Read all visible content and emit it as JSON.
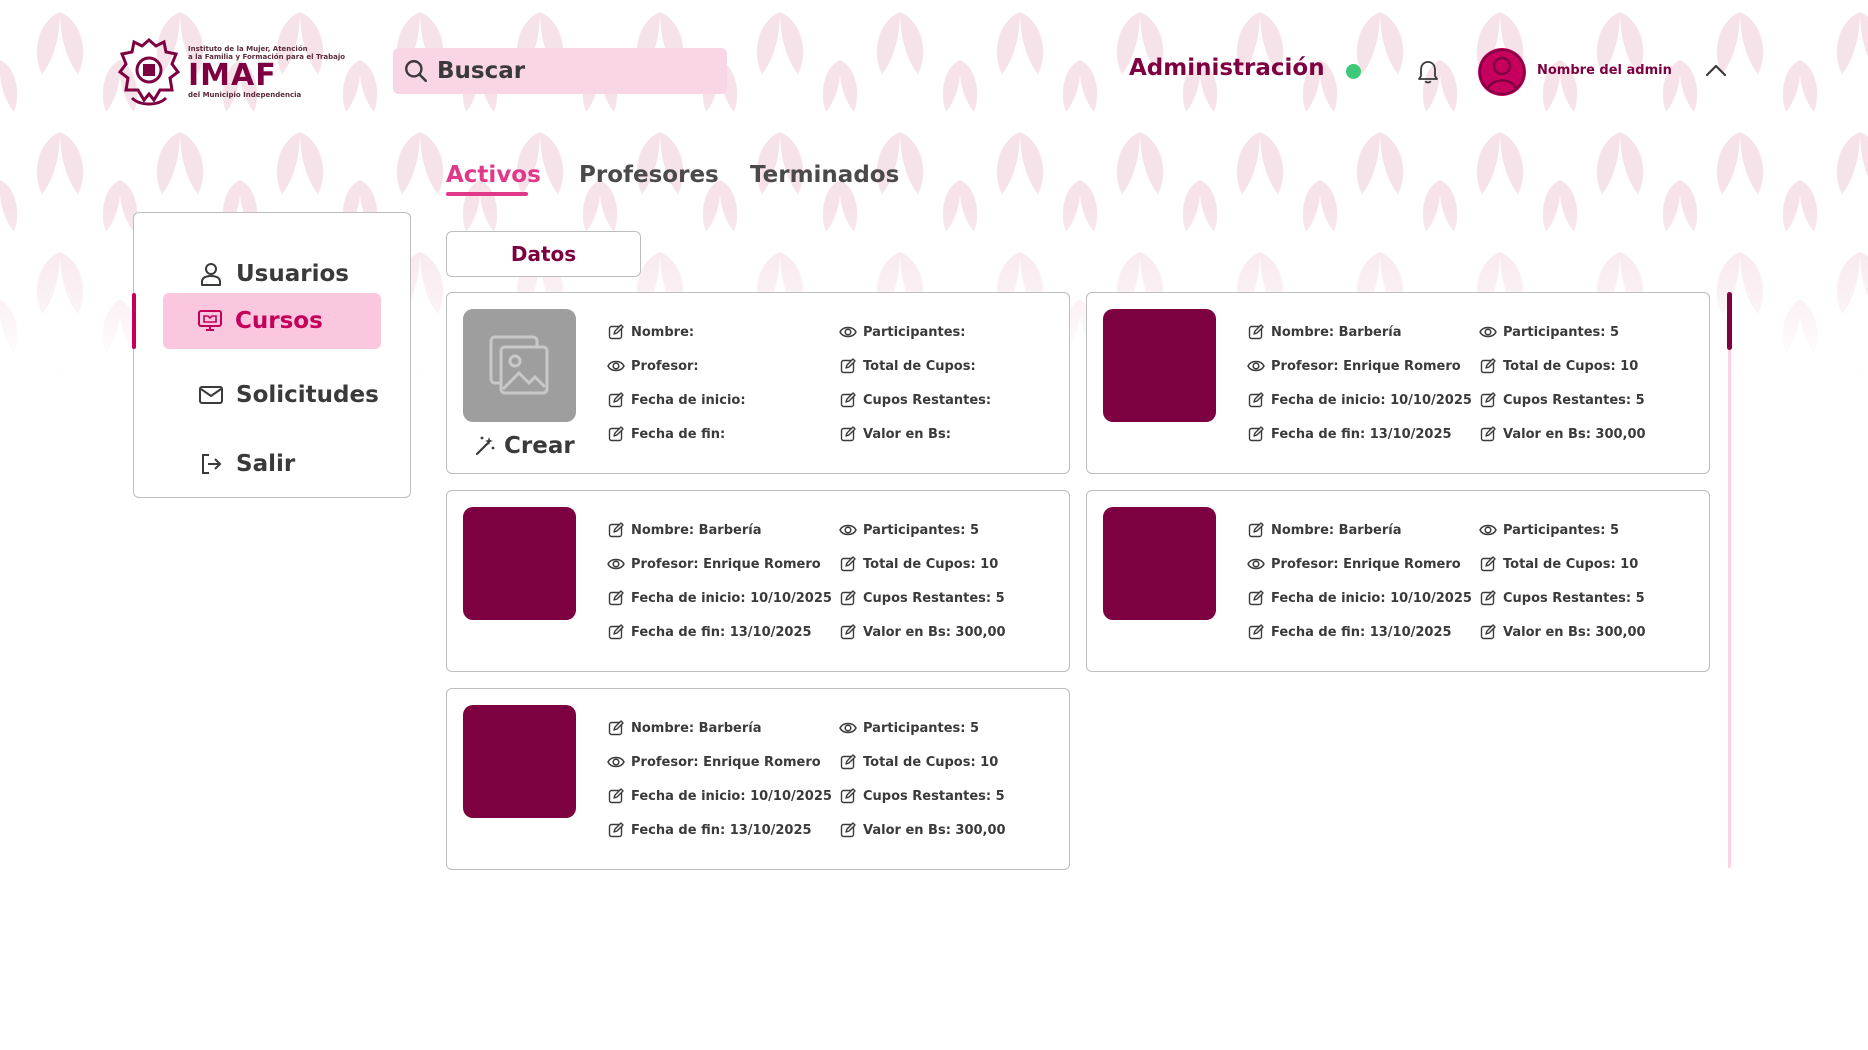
{
  "brand": {
    "name": "IMAF",
    "line1": "Instituto de la Mujer, Atención",
    "line2": "a la Familia y Formación para el Trabajo",
    "line3": "del Municipio Independencia"
  },
  "header": {
    "search_label": "Buscar",
    "title": "Administración",
    "admin_name": "Nombre del admin",
    "status_color": "#3ec97a"
  },
  "colors": {
    "brand": "#7d0040",
    "accent": "#e0388a",
    "active_bg": "#fbc7df",
    "search_bg": "#f9d6e6"
  },
  "tabs": [
    {
      "label": "Activos",
      "active": true
    },
    {
      "label": "Profesores",
      "active": false
    },
    {
      "label": "Terminados",
      "active": false
    }
  ],
  "sidebar": {
    "items": [
      {
        "label": "Usuarios",
        "icon": "user-icon"
      },
      {
        "label": "Cursos",
        "icon": "monitor-icon",
        "active": true
      },
      {
        "label": "Solicitudes",
        "icon": "mail-icon"
      },
      {
        "label": "Salir",
        "icon": "logout-icon"
      }
    ]
  },
  "datos_label": "Datos",
  "create_card": {
    "create_label": "Crear",
    "fields": {
      "nombre": "Nombre:",
      "profesor": "Profesor:",
      "fecha_inicio": "Fecha de inicio:",
      "fecha_fin": "Fecha de fin:",
      "participantes": "Participantes:",
      "total_cupos": "Total de Cupos:",
      "cupos_restantes": "Cupos Restantes:",
      "valor": "Valor en Bs:"
    }
  },
  "courses": [
    {
      "nombre": "Nombre: Barbería",
      "profesor": "Profesor: Enrique Romero",
      "fecha_inicio": "Fecha de inicio: 10/10/2025",
      "fecha_fin": "Fecha de fin: 13/10/2025",
      "participantes": "Participantes: 5",
      "total_cupos": "Total de Cupos: 10",
      "cupos_restantes": "Cupos Restantes: 5",
      "valor": "Valor en Bs: 300,00"
    },
    {
      "nombre": "Nombre: Barbería",
      "profesor": "Profesor: Enrique Romero",
      "fecha_inicio": "Fecha de inicio: 10/10/2025",
      "fecha_fin": "Fecha de fin: 13/10/2025",
      "participantes": "Participantes: 5",
      "total_cupos": "Total de Cupos: 10",
      "cupos_restantes": "Cupos Restantes: 5",
      "valor": "Valor en Bs: 300,00"
    },
    {
      "nombre": "Nombre: Barbería",
      "profesor": "Profesor: Enrique Romero",
      "fecha_inicio": "Fecha de inicio: 10/10/2025",
      "fecha_fin": "Fecha de fin: 13/10/2025",
      "participantes": "Participantes: 5",
      "total_cupos": "Total de Cupos: 10",
      "cupos_restantes": "Cupos Restantes: 5",
      "valor": "Valor en Bs: 300,00"
    },
    {
      "nombre": "Nombre: Barbería",
      "profesor": "Profesor: Enrique Romero",
      "fecha_inicio": "Fecha de inicio: 10/10/2025",
      "fecha_fin": "Fecha de fin: 13/10/2025",
      "participantes": "Participantes: 5",
      "total_cupos": "Total de Cupos: 10",
      "cupos_restantes": "Cupos Restantes: 5",
      "valor": "Valor en Bs: 300,00"
    }
  ]
}
